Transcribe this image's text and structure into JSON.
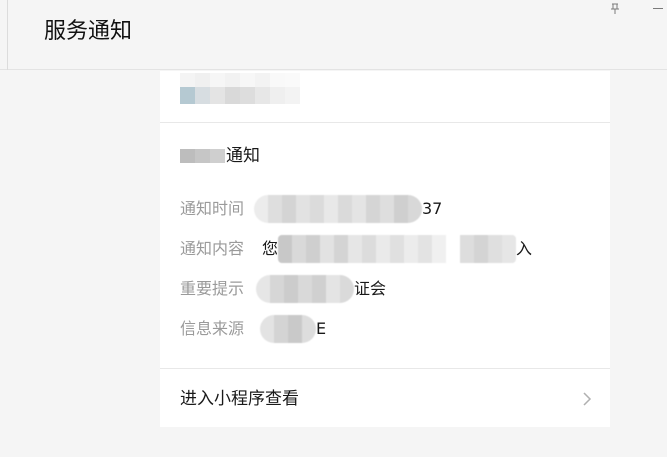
{
  "header": {
    "title": "服务通知",
    "pin_icon": "pin-icon",
    "minimize_icon": "minimize-icon"
  },
  "card": {
    "title_suffix": "通知",
    "rows": [
      {
        "label": "通知时间",
        "value_suffix": "37"
      },
      {
        "label": "通知内容",
        "value_prefix": "您",
        "value_suffix": "入"
      },
      {
        "label": "重要提示",
        "value_suffix": "证会"
      },
      {
        "label": "信息来源",
        "value_suffix": "E"
      }
    ],
    "footer_label": "进入小程序查看",
    "footer_icon": "chevron-right-icon"
  },
  "colors": {
    "page_bg": "#f5f5f5",
    "card_bg": "#ffffff",
    "label": "#9a9a9a",
    "text": "#191919"
  }
}
